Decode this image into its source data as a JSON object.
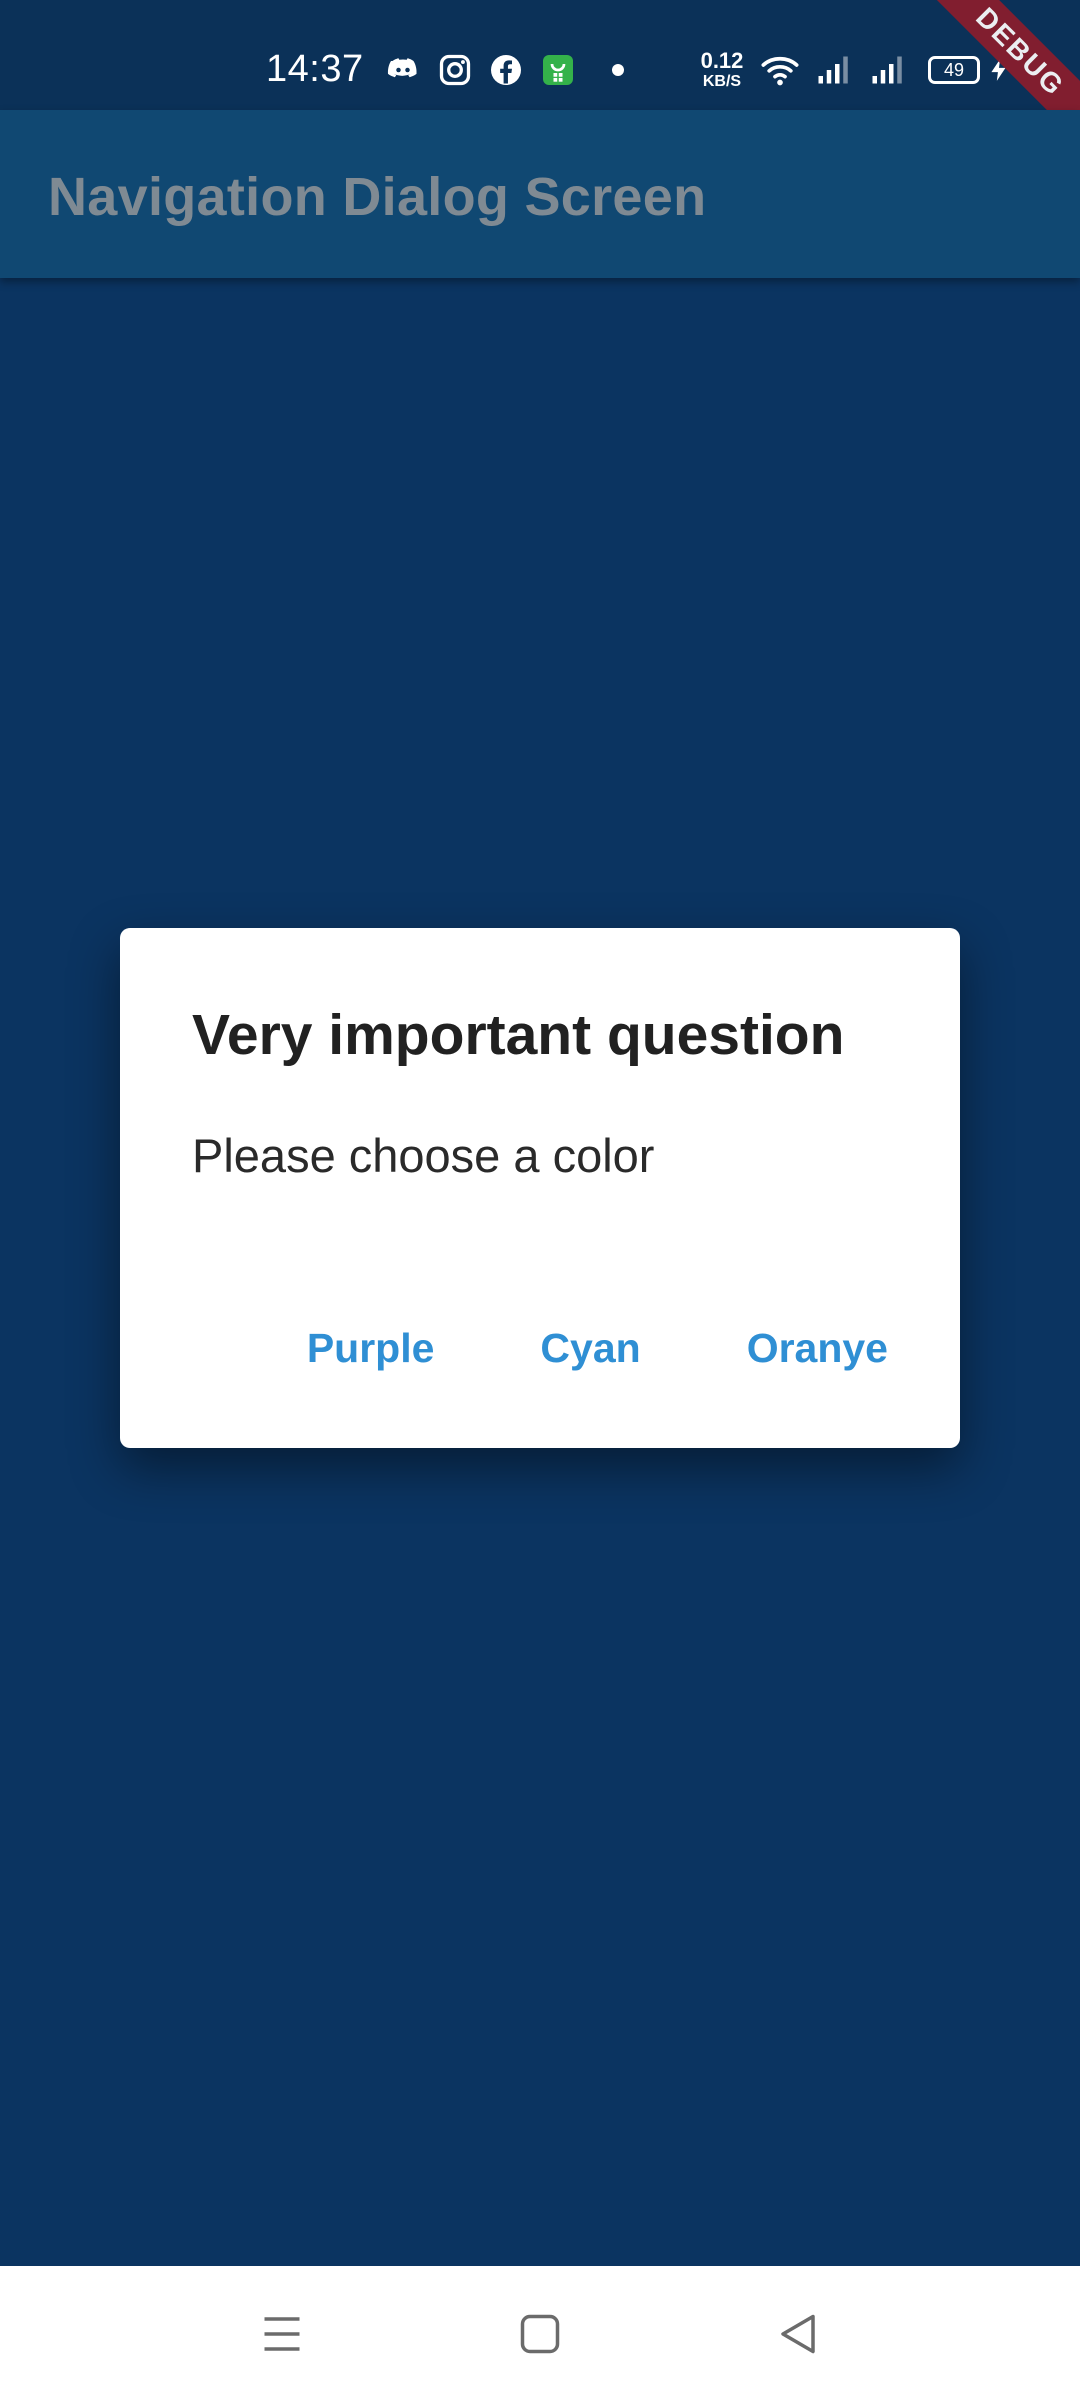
{
  "status_bar": {
    "time": "14:37",
    "net_speed_value": "0.12",
    "net_speed_unit": "KB/S",
    "battery_level": "49",
    "icons": [
      "discord-icon",
      "instagram-icon",
      "facebook-icon",
      "store-app-icon",
      "dot-icon",
      "wifi-icon",
      "signal-1-icon",
      "signal-2-icon",
      "battery-icon",
      "charging-icon"
    ]
  },
  "debug_banner": "DEBUG",
  "app_bar": {
    "title": "Navigation Dialog Screen"
  },
  "dialog": {
    "title": "Very important question",
    "content": "Please choose a color",
    "actions": [
      "Purple",
      "Cyan",
      "Oranye"
    ]
  },
  "nav_bar": {
    "icons": [
      "menu-icon",
      "home-icon",
      "back-icon"
    ]
  },
  "colors": {
    "background": "#0b3461",
    "app_bar": "#104872",
    "dialog_background": "#ffffff",
    "accent": "#2f8fd4",
    "debug_banner": "#8b1d2c"
  }
}
